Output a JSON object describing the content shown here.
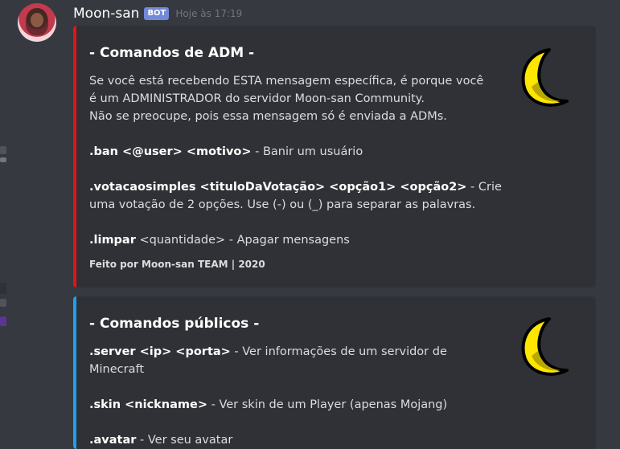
{
  "message": {
    "username": "Moon-san",
    "bot_tag": "BOT",
    "timestamp": "Hoje às 17:19"
  },
  "colors": {
    "background": "#36393f",
    "embed_bg": "#2f3136",
    "adm_bar": "#e3131a",
    "public_bar": "#1da1f2",
    "bot_tag": "#7289da"
  },
  "embeds": [
    {
      "title": "- Comandos de ADM -",
      "intro": [
        "Se você está recebendo ESTA mensagem específica, é porque você",
        "é um ADMINISTRADOR do servidor Moon-san Community.",
        "Não se preocupe, pois essa mensagem só é enviada a ADMs."
      ],
      "commands": [
        {
          "cmd": ".ban <@user> <motivo>",
          "desc": " - Banir um usuário"
        },
        {
          "cmd": ".votacaosimples <tituloDaVotação> <opção1> <opção2>",
          "desc": " - Crie",
          "cont": "uma votação de 2 opções. Use (-) ou (_) para separar as palavras."
        },
        {
          "cmd": ".limpar",
          "desc": " <quantidade> - Apagar mensagens"
        }
      ],
      "footer": "Feito por Moon-san TEAM | 2020",
      "thumbnail_icon": "crescent-moon-icon"
    },
    {
      "title": "- Comandos públicos -",
      "commands": [
        {
          "cmd": ".server <ip> <porta>",
          "desc": " - Ver informações de um servidor de",
          "cont": "Minecraft"
        },
        {
          "cmd": ".skin <nickname>",
          "desc": " - Ver skin de um Player (apenas Mojang)"
        },
        {
          "cmd": ".avatar",
          "desc": " - Ver seu avatar"
        }
      ],
      "thumbnail_icon": "crescent-moon-icon"
    }
  ]
}
